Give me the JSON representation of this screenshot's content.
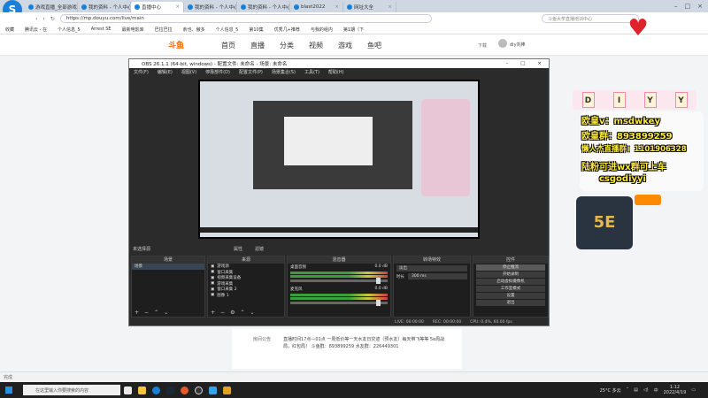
{
  "browser": {
    "tabs": [
      "游戏直播_全部游戏直播",
      "我的资料 - 个人中心",
      "直播中心",
      "我的资料 - 个人中心",
      "我的资料 - 个人中心",
      "blast2022",
      "网址大全"
    ],
    "address": "https://mp.douyu.com/live/main",
    "search_placeholder": "斗鱼大学直播培训中心",
    "bookmarks": [
      "收藏",
      "腾讯云 - 在",
      "个人信息_5",
      "Arrest SE",
      "最新电影库",
      "巴拉巴拉",
      "俞也、傲多",
      "个人信息_5",
      "第10集",
      "优秀几+推荐",
      "与我的组内",
      "第1期（下"
    ]
  },
  "douyu": {
    "logo": "斗鱼",
    "nav": [
      "首页",
      "直播",
      "分类",
      "视频",
      "游戏",
      "鱼吧"
    ],
    "download": "下载",
    "user": "diy刘棒",
    "announce_label": "房间公告",
    "announce_text": "直播时间17点—01点 一周低价等一天水友日灾迹（预水友）每天带飞等等 5e周战局，红包局！ 斗鱼群：893899259 水友群：226449301"
  },
  "obs": {
    "title": "OBS 26.1.1 (64-bit, windows) - 配置文件: 未命名 - 场景: 未命名",
    "menu": [
      "文件(F)",
      "编辑(E)",
      "视图(V)",
      "停靠部件(D)",
      "配置文件(P)",
      "场景集合(S)",
      "工具(T)",
      "帮助(H)"
    ],
    "no_source": "未选择源",
    "props": "属性",
    "filters": "滤镜",
    "panels": {
      "scenes": "场景",
      "sources": "来源",
      "mixer": "混音器",
      "transitions": "转场特效",
      "controls": "控件"
    },
    "scene_item": "场景",
    "sources": [
      "游戏源",
      "窗口采集",
      "视频采集设备",
      "游戏采集",
      "窗口采集 2",
      "图像 1"
    ],
    "mixer_tracks": [
      {
        "name": "桌面音频",
        "db": "0.0 dB"
      },
      {
        "name": "麦克风",
        "db": "0.0 dB"
      }
    ],
    "transition": "淡出",
    "duration_label": "时长",
    "duration": "300 ms",
    "controls": [
      "停止推流",
      "开始录制",
      "启动虚拟摄像机",
      "工作室模式",
      "设置",
      "退出"
    ],
    "status": [
      "LIVE: 00:00:00",
      "REC: 00:00:00",
      "CPU: 0.4%, 60.00 fps"
    ]
  },
  "overlay": {
    "letters": [
      "D",
      "I",
      "Y",
      "Y"
    ],
    "lines": [
      "欧皇v：msdwkey",
      "欧皇群：893899259",
      "懒人杰直播群：1101906328",
      "陆粉可进wx群可上车",
      "csgodiyyi"
    ]
  },
  "taskbar": {
    "search": "在这里输入你要搜索的内容",
    "weather": "25°C 多云",
    "time": "1:12",
    "date": "2022/4/19",
    "lang": "中"
  },
  "status_text": "完成"
}
